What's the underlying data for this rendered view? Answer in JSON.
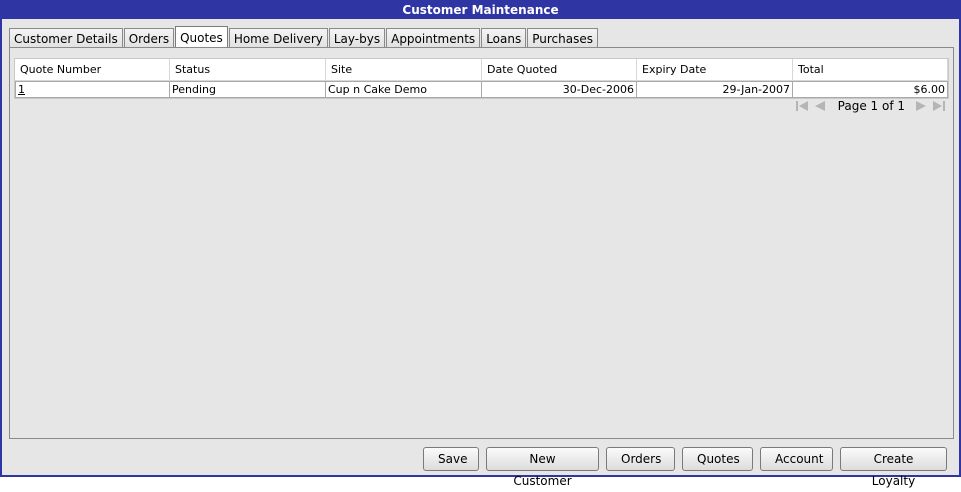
{
  "window": {
    "title": "Customer Maintenance"
  },
  "tabs": [
    {
      "label": "Customer Details",
      "active": false
    },
    {
      "label": "Orders",
      "active": false
    },
    {
      "label": "Quotes",
      "active": true
    },
    {
      "label": "Home Delivery",
      "active": false
    },
    {
      "label": "Lay-bys",
      "active": false
    },
    {
      "label": "Appointments",
      "active": false
    },
    {
      "label": "Loans",
      "active": false
    },
    {
      "label": "Purchases",
      "active": false
    }
  ],
  "grid": {
    "headers": [
      "Quote Number",
      "Status",
      "Site",
      "Date Quoted",
      "Expiry Date",
      "Total"
    ],
    "rows": [
      [
        "1",
        "Pending",
        "Cup n Cake Demo",
        "30-Dec-2006",
        "29-Jan-2007",
        "$6.00"
      ]
    ]
  },
  "pager": {
    "label": "Page 1 of 1"
  },
  "buttons": {
    "save": "Save",
    "new_customer": "New Customer",
    "orders": "Orders",
    "quotes": "Quotes",
    "account": "Account",
    "create_loyalty": "Create Loyalty"
  },
  "colors": {
    "titlebar": "#2f35a3",
    "background": "#e6e6e6"
  },
  "icons": [
    "first-page-icon",
    "previous-page-icon",
    "next-page-icon",
    "last-page-icon"
  ]
}
